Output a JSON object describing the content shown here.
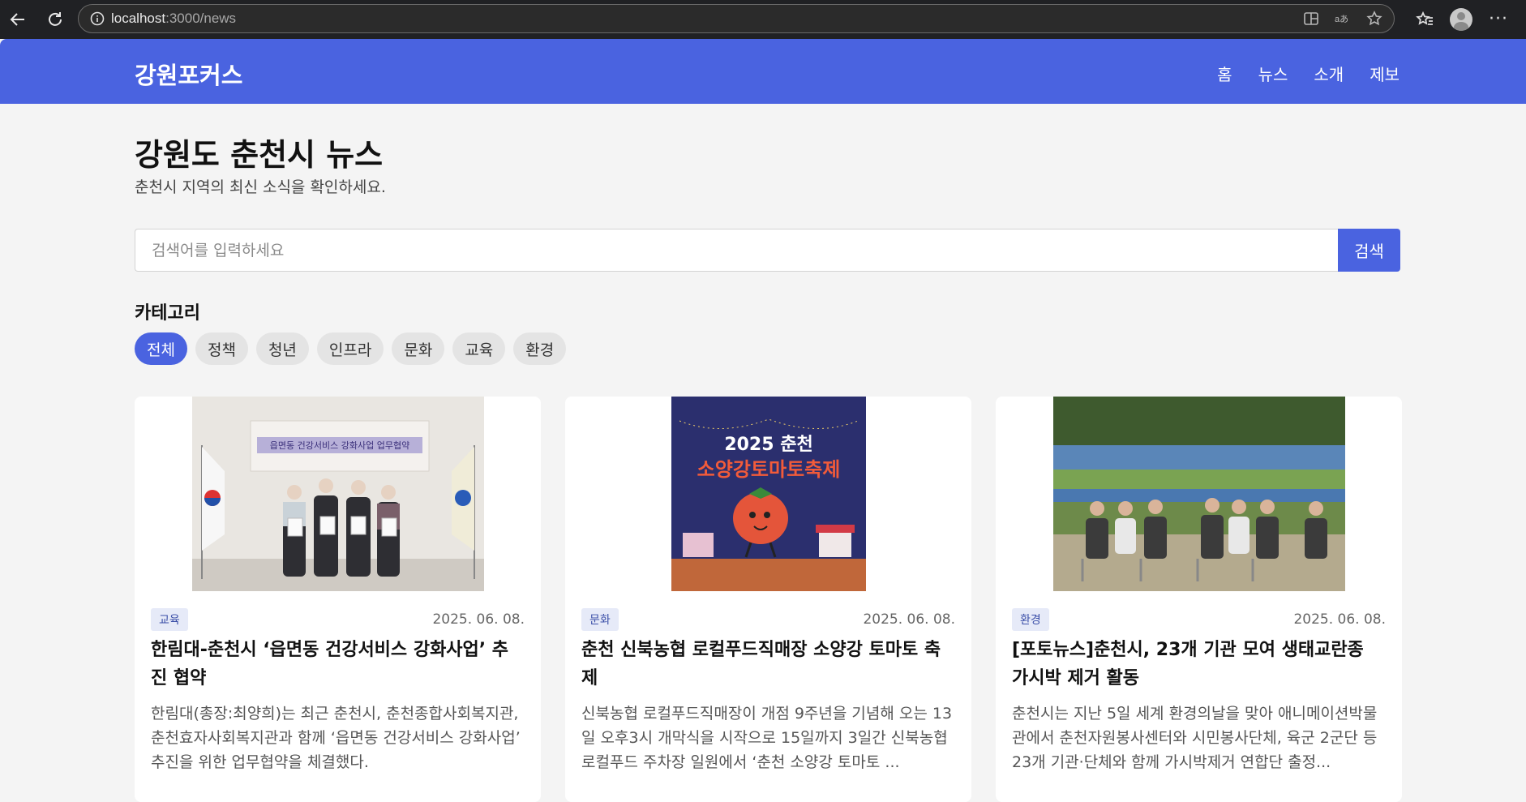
{
  "browser": {
    "url_host": "localhost",
    "url_path": ":3000/news"
  },
  "site": {
    "logo": "강원포커스",
    "nav": [
      "홈",
      "뉴스",
      "소개",
      "제보"
    ]
  },
  "page": {
    "title": "강원도 춘천시 뉴스",
    "subtitle": "춘천시 지역의 최신 소식을 확인하세요."
  },
  "search": {
    "placeholder": "검색어를 입력하세요",
    "button": "검색"
  },
  "categories": {
    "heading": "카테고리",
    "items": [
      "전체",
      "정책",
      "청년",
      "인프라",
      "문화",
      "교육",
      "환경"
    ],
    "active": "전체"
  },
  "articles": [
    {
      "tag": "교육",
      "date": "2025. 06. 08.",
      "title": "한림대-춘천시 ‘읍면동 건강서비스 강화사업’ 추진 협약",
      "excerpt": "한림대(총장:최양희)는 최근 춘천시, 춘천종합사회복지관, 춘천효자사회복지관과 함께 ‘읍면동 건강서비스 강화사업’ 추진을 위한 업무협약을 체결했다.",
      "image_banner_title": "읍면동 건강서비스 강화사업 업무협약"
    },
    {
      "tag": "문화",
      "date": "2025. 06. 08.",
      "title": "춘천 신북농협 로컬푸드직매장 소양강 토마토 축제",
      "excerpt": "신북농협 로컬푸드직매장이 개점 9주년을 기념해 오는 13일 오후3시 개막식을 시작으로 15일까지 3일간 신북농협 로컬푸드 주차장 일원에서 ‘춘천 소양강 토마토 ...",
      "poster_year": "2025 춘천",
      "poster_name": "소양강토마토축제"
    },
    {
      "tag": "환경",
      "date": "2025. 06. 08.",
      "title": "[포토뉴스]춘천시, 23개 기관 모여 생태교란종 가시박 제거 활동",
      "excerpt": "춘천시는 지난 5일 세계 환경의날을 맞아 애니메이션박물관에서 춘천자원봉사센터와 시민봉사단체, 육군 2군단 등 23개 기관·단체와 함께 가시박제거 연합단 출정..."
    }
  ],
  "colors": {
    "brand": "#4a63e0",
    "background": "#f4f4f4"
  }
}
